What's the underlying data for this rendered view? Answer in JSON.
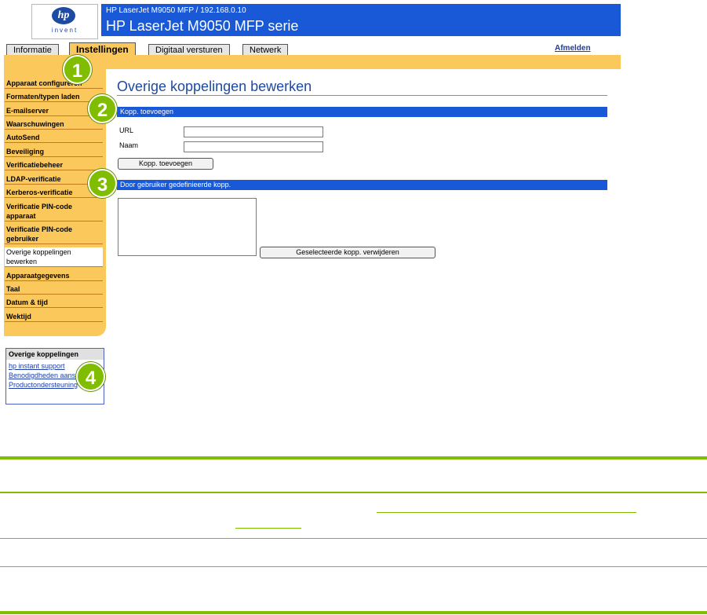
{
  "header": {
    "logo_mark": "hp",
    "logo_text": "invent",
    "subtitle": "HP LaserJet M9050 MFP / 192.168.0.10",
    "title": "HP LaserJet M9050 MFP serie"
  },
  "tabs": [
    {
      "label": "Informatie"
    },
    {
      "label": "Instellingen"
    },
    {
      "label": "Digitaal versturen"
    },
    {
      "label": "Netwerk"
    }
  ],
  "logout_label": "Afmelden",
  "sidebar": {
    "items": [
      {
        "label": "Apparaat configureren"
      },
      {
        "label": "Formaten/typen laden"
      },
      {
        "label": "E-mailserver"
      },
      {
        "label": "Waarschuwingen"
      },
      {
        "label": "AutoSend"
      },
      {
        "label": "Beveiliging"
      },
      {
        "label": "Verificatiebeheer"
      },
      {
        "label": "LDAP-verificatie"
      },
      {
        "label": "Kerberos-verificatie"
      },
      {
        "label": "Verificatie PIN-code apparaat"
      },
      {
        "label": "Verificatie PIN-code gebruiker"
      },
      {
        "label": "Overige koppelingen bewerken"
      },
      {
        "label": "Apparaatgegevens"
      },
      {
        "label": "Taal"
      },
      {
        "label": "Datum & tijd"
      },
      {
        "label": "Wektijd"
      }
    ]
  },
  "other_links": {
    "title": "Overige koppelingen",
    "items": [
      {
        "label": "hp instant support"
      },
      {
        "label": "Benodigdheden aanschaffen"
      },
      {
        "label": "Productondersteuning"
      }
    ]
  },
  "main": {
    "page_title": "Overige koppelingen bewerken",
    "add_section_title": "Kopp. toevoegen",
    "url_label": "URL",
    "url_value": "",
    "name_label": "Naam",
    "name_value": "",
    "add_button": "Kopp. toevoegen",
    "user_section_title": "Door gebruiker gedefinieerde kopp.",
    "remove_button": "Geselecteerde kopp. verwijderen"
  },
  "callouts": [
    "1",
    "2",
    "3",
    "4"
  ],
  "colors": {
    "accent_blue": "#1958d6",
    "tab_orange": "#fbc95b",
    "callout_green": "#80bc00"
  }
}
